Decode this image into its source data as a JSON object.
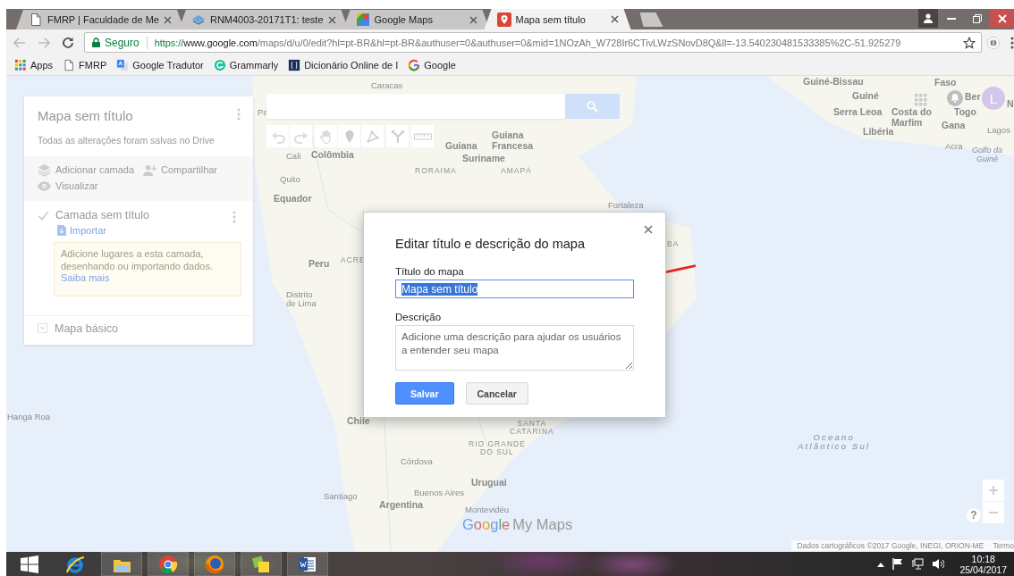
{
  "browser": {
    "tabs": [
      {
        "title": "FMRP | Faculdade de Me",
        "kind": "page",
        "selected": false
      },
      {
        "title": "RNM4003-20171T1: teste",
        "kind": "course",
        "selected": false
      },
      {
        "title": "Google Maps",
        "kind": "maps",
        "selected": false
      },
      {
        "title": "Mapa sem título",
        "kind": "pin",
        "selected": true
      }
    ],
    "address_bar": {
      "security_label": "Seguro",
      "scheme": "https://",
      "host": "www.google.com",
      "path": "/maps/d/u/0/edit?hl=pt-BR&hl=pt-BR&authuser=0&authuser=0&mid=1NOzAh_W728Ir6CTivLWzSNovD8Q&ll=-13.540230481533385%2C-51.925279"
    },
    "bookmarks": [
      {
        "label": "Apps",
        "kind": "apps"
      },
      {
        "label": "FMRP",
        "kind": "page"
      },
      {
        "label": "Google Tradutor",
        "kind": "translate"
      },
      {
        "label": "Grammarly",
        "kind": "grammarly"
      },
      {
        "label": "Dicionário Online de I",
        "kind": "dictionary"
      },
      {
        "label": "Google",
        "kind": "google"
      }
    ]
  },
  "map": {
    "labels": [
      {
        "text": "Caracas",
        "kind": "city"
      },
      {
        "text": "Guiné-Bissau",
        "kind": "country"
      },
      {
        "text": "Faso",
        "kind": "country"
      },
      {
        "text": "Guiné",
        "kind": "country"
      },
      {
        "text": "Ber",
        "kind": "country"
      },
      {
        "text": "N",
        "kind": "country"
      },
      {
        "text": "Pa",
        "kind": "city"
      },
      {
        "text": "Serra Leoa",
        "kind": "country"
      },
      {
        "text": "Costa do\nMarfim",
        "kind": "country"
      },
      {
        "text": "Togo",
        "kind": "country"
      },
      {
        "text": "Gana",
        "kind": "country"
      },
      {
        "text": "Libéria",
        "kind": "country"
      },
      {
        "text": "Lagos",
        "kind": "city"
      },
      {
        "text": "Guiana",
        "kind": "country"
      },
      {
        "text": "Guiana\nFrancesa",
        "kind": "country"
      },
      {
        "text": "Acra",
        "kind": "city"
      },
      {
        "text": "Cali",
        "kind": "city"
      },
      {
        "text": "Colômbia",
        "kind": "country"
      },
      {
        "text": "Suriname",
        "kind": "country"
      },
      {
        "text": "Golfo da\nGuiné",
        "kind": "water"
      },
      {
        "text": "RORAIMA",
        "kind": "region"
      },
      {
        "text": "AMAPÁ",
        "kind": "region"
      },
      {
        "text": "Quito",
        "kind": "city"
      },
      {
        "text": "Equador",
        "kind": "country"
      },
      {
        "text": "Fortaleza",
        "kind": "city"
      },
      {
        "text": "BA",
        "kind": "region"
      },
      {
        "text": "Peru",
        "kind": "country"
      },
      {
        "text": "ACRE",
        "kind": "region"
      },
      {
        "text": "Distrito\nde Lima",
        "kind": "city"
      },
      {
        "text": "Hanga Roa",
        "kind": "city"
      },
      {
        "text": "Chile",
        "kind": "country"
      },
      {
        "text": "SANTA\nCATARINA",
        "kind": "region"
      },
      {
        "text": "Oceano\nAtlântico Sul",
        "kind": "ocean"
      },
      {
        "text": "RIO GRANDE\nDO SUL",
        "kind": "region"
      },
      {
        "text": "Córdova",
        "kind": "city"
      },
      {
        "text": "Uruguai",
        "kind": "country"
      },
      {
        "text": "Santiago",
        "kind": "city"
      },
      {
        "text": "Buenos Aires",
        "kind": "city"
      },
      {
        "text": "Argentina",
        "kind": "country"
      },
      {
        "text": "Montevidéu",
        "kind": "city"
      }
    ],
    "tool_groups": [
      [
        {
          "kind": "undo"
        },
        {
          "kind": "redo"
        }
      ],
      [
        {
          "kind": "hand"
        },
        {
          "kind": "marker"
        },
        {
          "kind": "line"
        }
      ],
      [
        {
          "kind": "route"
        }
      ],
      [
        {
          "kind": "ruler"
        }
      ]
    ],
    "account": {
      "avatar_letter": "L"
    },
    "help": "?",
    "logo": {
      "brand": "Google",
      "product": "My Maps"
    },
    "attribution": "Dados cartográficos ©2017 Google, INEGI, ORION-ME",
    "terms": "Termo"
  },
  "side_panel": {
    "title": "Mapa sem título",
    "subtitle": "Todas as alterações foram salvas no Drive",
    "actions": [
      {
        "kind": "add-layer",
        "label": "Adicionar camada"
      },
      {
        "kind": "share",
        "label": "Compartilhar"
      },
      {
        "kind": "preview",
        "label": "Visualizar"
      }
    ],
    "layers": [
      {
        "name": "Camada sem título",
        "checked": true,
        "import_label": "Importar",
        "hint": "Adicione lugares a esta camada, desenhando ou importando dados.",
        "hint_link": "Saiba mais"
      }
    ],
    "base_map": {
      "label": "Mapa básico"
    }
  },
  "dialog": {
    "title": "Editar título e descrição do mapa",
    "fields": [
      {
        "kind": "text",
        "label": "Título do mapa",
        "value": "Mapa sem título",
        "focused": true,
        "value_selected": true
      },
      {
        "kind": "textarea",
        "label": "Descrição",
        "placeholder": "Adicione uma descrição para ajudar os usuários a entender seu mapa"
      }
    ],
    "buttons": [
      {
        "kind": "primary",
        "label": "Salvar"
      },
      {
        "kind": "secondary",
        "label": "Cancelar"
      }
    ]
  },
  "taskbar": {
    "apps": [
      {
        "kind": "ie"
      },
      {
        "kind": "explorer"
      },
      {
        "kind": "chrome"
      },
      {
        "kind": "firefox"
      },
      {
        "kind": "notes"
      },
      {
        "kind": "word"
      }
    ],
    "time": "10:18",
    "date": "25/04/2017"
  }
}
